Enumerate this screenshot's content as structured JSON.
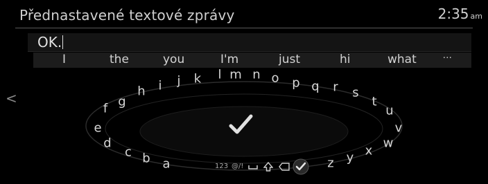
{
  "header": {
    "title": "Přednastavené textové zprávy",
    "time": "2:35",
    "ampm": "am"
  },
  "input": {
    "value": "OK."
  },
  "suggestions": [
    "I",
    "the",
    "you",
    "I'm",
    "just",
    "hi",
    "what"
  ],
  "more": "···",
  "nav": {
    "back_glyph": "<"
  },
  "keyboard": {
    "keys": [
      "a",
      "b",
      "c",
      "d",
      "e",
      "f",
      "g",
      "h",
      "i",
      "j",
      "k",
      "l",
      "m",
      "n",
      "o",
      "p",
      "q",
      "r",
      "s",
      "t",
      "u",
      "v",
      "w",
      "x",
      "y",
      "z"
    ],
    "bottom": {
      "numbers": "123",
      "symbols": "@/!"
    },
    "icons": {
      "confirm": "checkmark-icon",
      "space": "space-icon",
      "shift": "shift-icon",
      "delete": "delete-icon",
      "done": "done-icon"
    }
  },
  "colors": {
    "background": "#000000",
    "text": "#d8d8d8",
    "ring": "#3a3a3a"
  }
}
